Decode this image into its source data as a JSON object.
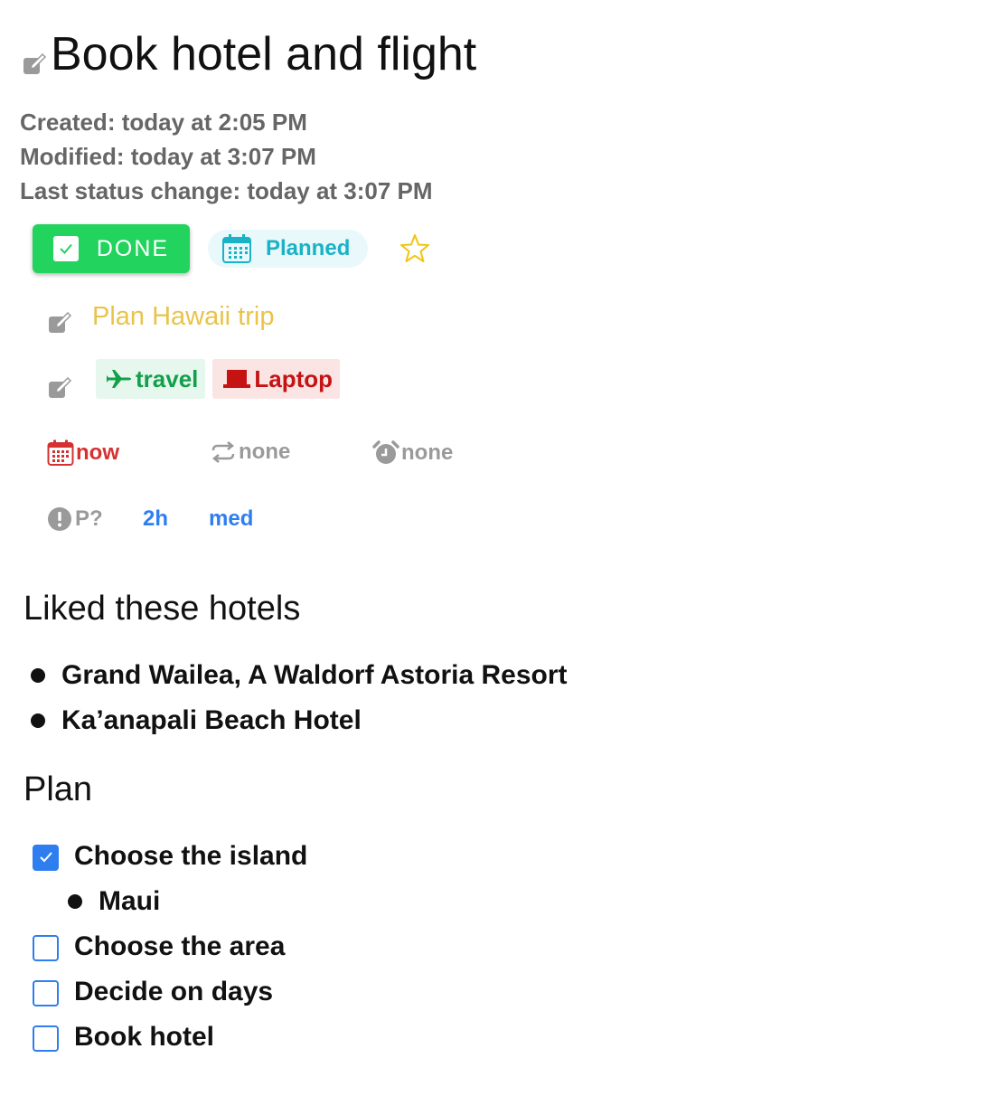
{
  "task": {
    "title": "Book hotel and flight",
    "created": "Created: today at 2:05 PM",
    "modified": "Modified: today at 3:07 PM",
    "last_status_change": "Last status change: today at 3:07 PM"
  },
  "status": {
    "done_label": "DONE",
    "planned_label": "Planned",
    "done_color": "#22d35e",
    "planned_color": "#19b2c6",
    "star_color": "#f2c40f"
  },
  "project": {
    "label": "Plan Hawaii trip",
    "color": "#e9c34b"
  },
  "tags": [
    {
      "label": "travel",
      "icon": "airplane-icon",
      "color": "#12a04a"
    },
    {
      "label": "Laptop",
      "icon": "laptop-icon",
      "color": "#c51313"
    }
  ],
  "schedule": {
    "start": "now",
    "repeat": "none",
    "reminder": "none"
  },
  "attributes": {
    "priority": "P?",
    "duration": "2h",
    "energy": "med"
  },
  "notes": {
    "hotels_heading": "Liked these hotels",
    "hotels": [
      "Grand Wailea, A Waldorf Astoria Resort",
      "Ka’anapali Beach Hotel"
    ],
    "plan_heading": "Plan",
    "plan": [
      {
        "label": "Choose the island",
        "checked": true
      },
      {
        "label": "Maui",
        "sub": true
      },
      {
        "label": "Choose the area",
        "checked": false
      },
      {
        "label": "Decide on days",
        "checked": false
      },
      {
        "label": "Book hotel",
        "checked": false
      }
    ]
  }
}
